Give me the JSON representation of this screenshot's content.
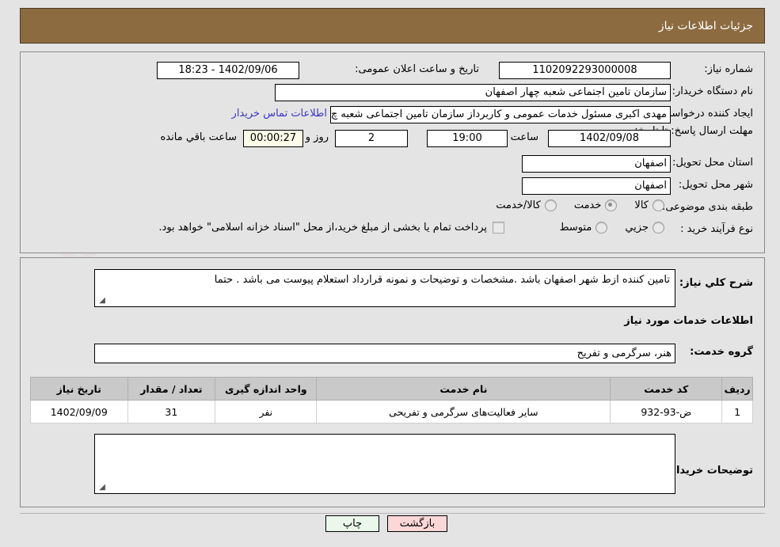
{
  "header": {
    "title": "جزئیات اطلاعات نیاز"
  },
  "top": {
    "need_number_label": "شماره نیاز:",
    "need_number_value": "1102092293000008",
    "announce_label": "تاریخ و ساعت اعلان عمومی:",
    "announce_value": "1402/09/06 - 18:23",
    "buyer_org_label": "نام دستگاه خریدار:",
    "buyer_org_value": "سازمان تامین اجتماعی شعبه چهار اصفهان",
    "creator_label": "ایجاد کننده درخواست:",
    "creator_value": "مهدی اکبری مسئول خدمات عمومی و کاربرداز سازمان تامین اجتماعی شعبه چ",
    "contact_link": "اطلاعات تماس خریدار",
    "deadline_label": "مهلت ارسال پاسخ: تا تاریخ:",
    "deadline_date": "1402/09/08",
    "hour_label": "ساعت",
    "hour_value": "19:00",
    "days_value": "2",
    "days_label": "روز و",
    "countdown_value": "00:00:27",
    "countdown_label": "ساعت باقي مانده",
    "province_label": "استان محل تحویل:",
    "province_value": "اصفهان",
    "city_label": "شهر محل تحویل:",
    "city_value": "اصفهان",
    "category_label": "طبقه بندی موضوعی:",
    "category_options": [
      {
        "label": "کالا",
        "selected": false
      },
      {
        "label": "خدمت",
        "selected": true
      },
      {
        "label": "کالا/خدمت",
        "selected": false
      }
    ],
    "process_label": "نوع فرآیند خرید :",
    "process_options": [
      {
        "label": "جزیي",
        "selected": false
      },
      {
        "label": "متوسط",
        "selected": false
      }
    ],
    "treasury_checkbox_label": "پرداخت تمام یا بخشی از مبلغ خرید،از محل \"اسناد خزانه اسلامی\" خواهد بود."
  },
  "mid": {
    "general_desc_label": "شرح کلي نياز:",
    "general_desc_value": "تامین کننده ازط شهر اصفهان باشد .مشخصات و توضیحات و نمونه قرارداد  استعلام پیوست می باشد . حتما",
    "services_section_title": "اطلاعات خدمات مورد نیاز",
    "service_group_label": "گروه خدمت:",
    "service_group_value": "هنر، سرگرمی و تفریح",
    "table": {
      "columns": [
        "ردیف",
        "کد خدمت",
        "نام خدمت",
        "واحد اندازه گیری",
        "تعداد / مقدار",
        "تاریخ نیاز"
      ],
      "rows": [
        [
          "1",
          "ض-93-932",
          "سایر فعالیت‌های سرگرمی و تفریحی",
          "نفر",
          "31",
          "1402/09/09"
        ]
      ]
    },
    "buyer_notes_label": "توضیحات خریدار;",
    "buyer_notes_value": ""
  },
  "footer": {
    "print_label": "چاپ",
    "back_label": "بازگشت"
  },
  "watermark": {
    "text": "AriaTender.net"
  }
}
